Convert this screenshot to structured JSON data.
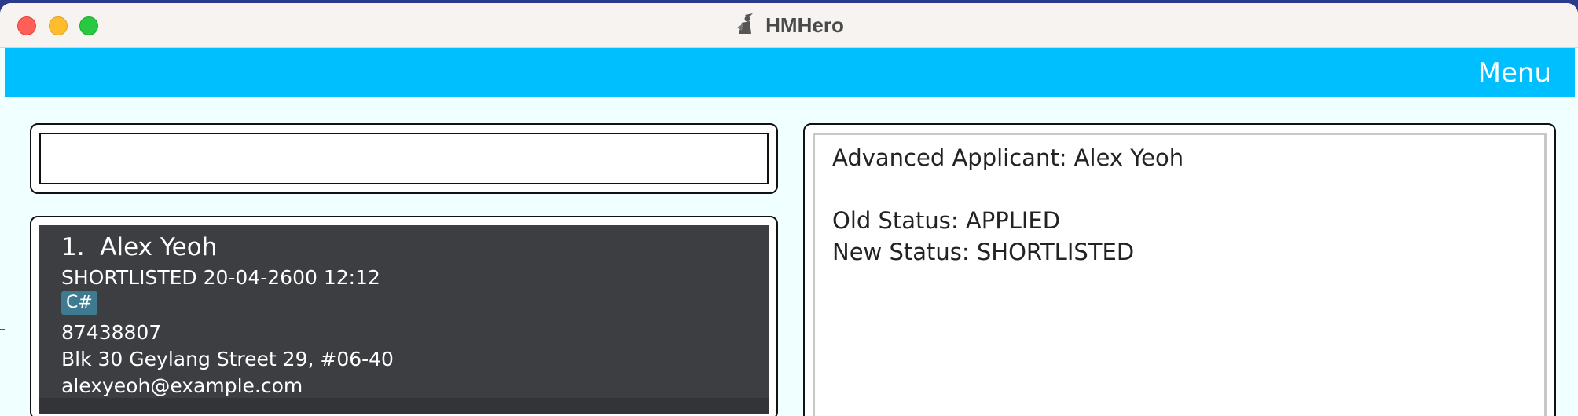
{
  "window": {
    "title": "HMHero",
    "app_icon": "hmhero-hero-icon"
  },
  "menubar": {
    "menu_label": "Menu"
  },
  "command": {
    "value": "",
    "placeholder": ""
  },
  "applicants": [
    {
      "index": "1.",
      "name": "Alex Yeoh",
      "status_line": "SHORTLISTED 20-04-2600 12:12",
      "tags": [
        "C#"
      ],
      "phone": "87438807",
      "address": "Blk 30 Geylang Street 29, #06-40",
      "email": "alexyeoh@example.com"
    }
  ],
  "result": {
    "line1": "Advanced Applicant: Alex Yeoh",
    "line2": "Old Status: APPLIED",
    "line3": "New Status: SHORTLISTED"
  },
  "colors": {
    "menubar": "#00bfff",
    "background": "#f0ffff",
    "card": "#3c3e42",
    "tag": "#3e7b91"
  }
}
